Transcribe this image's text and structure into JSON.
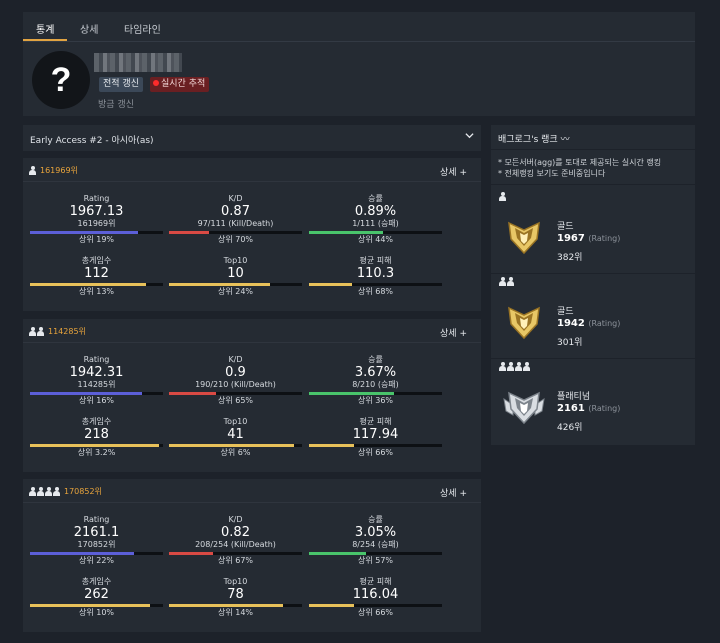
{
  "tabs": [
    {
      "label": "통계",
      "active": true
    },
    {
      "label": "상세",
      "active": false
    },
    {
      "label": "타임라인",
      "active": false
    }
  ],
  "profile": {
    "avatar_glyph": "?",
    "refresh_label": "전적 갱신",
    "live_label": "실시간 추적",
    "updated_text": "방금 갱신"
  },
  "season": {
    "label": "Early Access #2 - 아시아(as)"
  },
  "detail_label": "상세 +",
  "colors": {
    "accent": "#e2a442",
    "rating_bar": "#5c5fd8",
    "kd_bar": "#d94a44",
    "win_bar": "#49c46b",
    "yellow_bar": "#e8c15a"
  },
  "cards": [
    {
      "mode": "solo",
      "rank": "161969위",
      "rating": {
        "label": "Rating",
        "value": "1967.13",
        "sub": "161969위",
        "pct": "상위 19%",
        "fill": 0.81
      },
      "kd": {
        "label": "K/D",
        "value": "0.87",
        "sub": "97/111 (Kill/Death)",
        "pct": "상위 70%",
        "fill": 0.3
      },
      "win": {
        "label": "승률",
        "value": "0.89%",
        "sub": "1/111 (승패)",
        "pct": "상위 44%",
        "fill": 0.56
      },
      "games": {
        "label": "총게임수",
        "value": "112",
        "pct": "상위 13%",
        "fill": 0.87
      },
      "top10": {
        "label": "Top10",
        "value": "10",
        "pct": "상위 24%",
        "fill": 0.76
      },
      "dmg": {
        "label": "평균 피해",
        "value": "110.3",
        "pct": "상위 68%",
        "fill": 0.32
      }
    },
    {
      "mode": "duo",
      "rank": "114285위",
      "rating": {
        "label": "Rating",
        "value": "1942.31",
        "sub": "114285위",
        "pct": "상위 16%",
        "fill": 0.84
      },
      "kd": {
        "label": "K/D",
        "value": "0.9",
        "sub": "190/210 (Kill/Death)",
        "pct": "상위 65%",
        "fill": 0.35
      },
      "win": {
        "label": "승률",
        "value": "3.67%",
        "sub": "8/210 (승패)",
        "pct": "상위 36%",
        "fill": 0.64
      },
      "games": {
        "label": "총게임수",
        "value": "218",
        "pct": "상위 3.2%",
        "fill": 0.968
      },
      "top10": {
        "label": "Top10",
        "value": "41",
        "pct": "상위 6%",
        "fill": 0.94
      },
      "dmg": {
        "label": "평균 피해",
        "value": "117.94",
        "pct": "상위 66%",
        "fill": 0.34
      }
    },
    {
      "mode": "squad",
      "rank": "170852위",
      "rating": {
        "label": "Rating",
        "value": "2161.1",
        "sub": "170852위",
        "pct": "상위 22%",
        "fill": 0.78
      },
      "kd": {
        "label": "K/D",
        "value": "0.82",
        "sub": "208/254 (Kill/Death)",
        "pct": "상위 67%",
        "fill": 0.33
      },
      "win": {
        "label": "승률",
        "value": "3.05%",
        "sub": "8/254 (승패)",
        "pct": "상위 57%",
        "fill": 0.43
      },
      "games": {
        "label": "총게임수",
        "value": "262",
        "pct": "상위 10%",
        "fill": 0.9
      },
      "top10": {
        "label": "Top10",
        "value": "78",
        "pct": "상위 14%",
        "fill": 0.86
      },
      "dmg": {
        "label": "평균 피해",
        "value": "116.04",
        "pct": "상위 66%",
        "fill": 0.34
      }
    }
  ],
  "rank_panel": {
    "title": "배그로그's 랭크",
    "title_icon": "trend-icon",
    "notes": [
      "* 모든서버(agg)를 토대로 제공되는 실시간 랭킹",
      "* 전체랭킹 보기도 준비중입니다"
    ],
    "tiers": [
      {
        "mode": "solo",
        "tier": "골드",
        "rating": "1967",
        "rating_unit": "(Rating)",
        "rank": "382위",
        "emblem": "gold-emblem"
      },
      {
        "mode": "duo",
        "tier": "골드",
        "rating": "1942",
        "rating_unit": "(Rating)",
        "rank": "301위",
        "emblem": "gold-emblem"
      },
      {
        "mode": "squad",
        "tier": "플래티넘",
        "rating": "2161",
        "rating_unit": "(Rating)",
        "rank": "426위",
        "emblem": "platinum-emblem"
      }
    ]
  }
}
